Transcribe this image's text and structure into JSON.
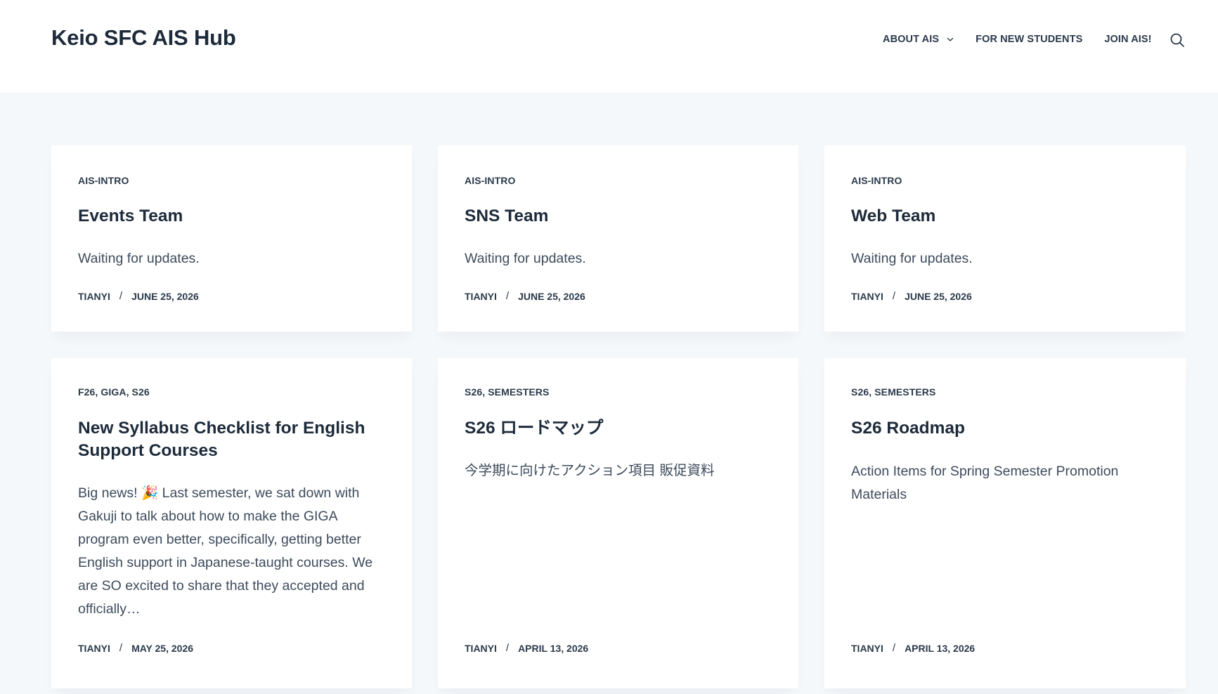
{
  "site": {
    "title": "Keio SFC AIS Hub"
  },
  "nav": {
    "items": [
      {
        "label": "ABOUT AIS",
        "has_dropdown": true
      },
      {
        "label": "FOR NEW STUDENTS",
        "has_dropdown": false
      },
      {
        "label": "JOIN AIS!",
        "has_dropdown": false
      }
    ],
    "search_icon": "search-icon"
  },
  "colors": {
    "page_background": "#f5f8fa",
    "card_background": "#ffffff",
    "heading": "#1d2a3a",
    "body_text": "#3d4b5c"
  },
  "posts": [
    {
      "categories": "AIS-INTRO",
      "title": "Events Team",
      "excerpt": "Waiting for updates.",
      "author": "TIANYI",
      "separator": "/",
      "date": "JUNE 25, 2026"
    },
    {
      "categories": "AIS-INTRO",
      "title": "SNS Team",
      "excerpt": "Waiting for updates.",
      "author": "TIANYI",
      "separator": "/",
      "date": "JUNE 25, 2026"
    },
    {
      "categories": "AIS-INTRO",
      "title": "Web Team",
      "excerpt": "Waiting for updates.",
      "author": "TIANYI",
      "separator": "/",
      "date": "JUNE 25, 2026"
    },
    {
      "categories": "F26, GIGA, S26",
      "title": "New Syllabus Checklist for English Support Courses",
      "excerpt": "Big news! 🎉 Last semester, we sat down with Gakuji to talk about how to make the GIGA program even better, specifically, getting better English support in Japanese-taught courses. We are SO excited to share that they accepted and officially…",
      "author": "TIANYI",
      "separator": "/",
      "date": "MAY 25, 2026"
    },
    {
      "categories": "S26, SEMESTERS",
      "title": "S26 ロードマップ",
      "excerpt": "今学期に向けたアクション項目 販促資料",
      "author": "TIANYI",
      "separator": "/",
      "date": "APRIL 13, 2026"
    },
    {
      "categories": "S26, SEMESTERS",
      "title": "S26 Roadmap",
      "excerpt": "Action Items for Spring Semester Promotion Materials",
      "author": "TIANYI",
      "separator": "/",
      "date": "APRIL 13, 2026"
    }
  ]
}
